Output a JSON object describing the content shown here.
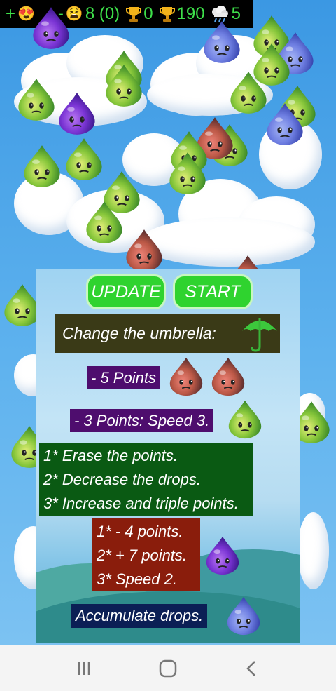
{
  "hud": {
    "plus": "+",
    "emoji_love": "😍",
    "dash": "-",
    "emoji_sad": "😫",
    "drops_value": "8 (0)",
    "trophy_value": "0",
    "trophy_total": "190",
    "weather_value": "5"
  },
  "buttons": {
    "update": "UPDATE",
    "start": "START"
  },
  "panel": {
    "change_umbrella": "Change the umbrella:",
    "minus_five": "- 5 Points",
    "minus_three": "- 3 Points: Speed 3.",
    "green_options": [
      "1* Erase the points.",
      "2* Decrease the drops.",
      "3* Increase and triple points."
    ],
    "red_options": [
      "1* - 4 points.",
      "2* + 7 points.",
      "3* Speed 2."
    ],
    "accumulate": "Accumulate drops."
  },
  "colors": {
    "hud_text": "#3ee04a",
    "button_green": "#2fd32f",
    "label_olive": "#3a3a17",
    "label_purple": "#4e0d6e",
    "label_green": "#0a5a13",
    "label_red": "#8a1d0c",
    "label_navy": "#0b1f55"
  },
  "icons": [
    "love-emoji-icon",
    "tired-emoji-icon",
    "trophy-icon",
    "rain-cloud-icon",
    "umbrella-icon",
    "recent-apps-icon",
    "home-icon",
    "back-icon"
  ]
}
